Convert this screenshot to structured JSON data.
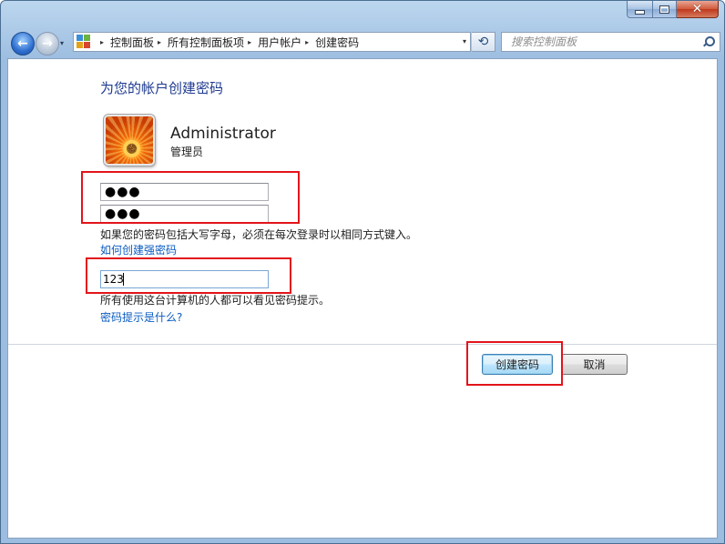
{
  "window": {
    "caption_buttons": {
      "minimize_icon": "minimize-icon",
      "maximize_icon": "maximize-icon",
      "close_icon": "close-icon",
      "close_glyph": "✕"
    }
  },
  "nav": {
    "back_glyph": "←",
    "forward_glyph": "→",
    "history_glyph": "▾"
  },
  "address_bar": {
    "separator": "▸",
    "breadcrumbs": [
      "控制面板",
      "所有控制面板项",
      "用户帐户",
      "创建密码"
    ],
    "dropdown_glyph": "▾",
    "refresh_glyph": "⟲"
  },
  "search": {
    "placeholder": "搜索控制面板"
  },
  "page": {
    "heading": "为您的帐户创建密码",
    "account": {
      "name": "Administrator",
      "role": "管理员"
    },
    "new_password": "●●●",
    "confirm_password": "●●●",
    "case_note": "如果您的密码包括大写字母，必须在每次登录时以相同方式键入。",
    "strong_password_link": "如何创建强密码",
    "hint_value": "123",
    "hint_note": "所有使用这台计算机的人都可以看见密码提示。",
    "hint_link": "密码提示是什么?"
  },
  "buttons": {
    "create": "创建密码",
    "cancel": "取消"
  },
  "colors": {
    "annotation_red": "#e3141a",
    "link_blue": "#0b5cc1",
    "heading_blue": "#1e3a8f"
  }
}
